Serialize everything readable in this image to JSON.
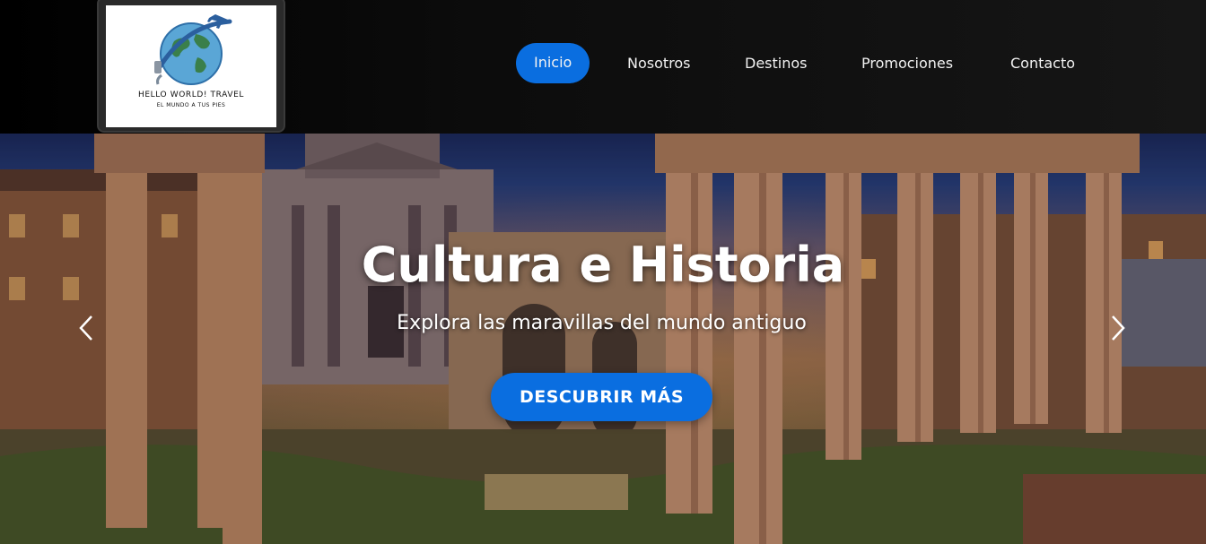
{
  "logo": {
    "title": "HELLO WORLD! TRAVEL",
    "subtitle": "EL MUNDO A TUS PIES",
    "icon": "globe-airplane-logo"
  },
  "nav": {
    "items": [
      {
        "label": "Inicio",
        "active": true
      },
      {
        "label": "Nosotros",
        "active": false
      },
      {
        "label": "Destinos",
        "active": false
      },
      {
        "label": "Promociones",
        "active": false
      },
      {
        "label": "Contacto",
        "active": false
      }
    ]
  },
  "hero": {
    "title": "Cultura e Historia",
    "subtitle": "Explora las maravillas del mundo antiguo",
    "cta_label": "DESCUBRIR MÁS",
    "prev_icon": "chevron-left-icon",
    "next_icon": "chevron-right-icon"
  },
  "colors": {
    "accent": "#0a6ee0",
    "header_bg": "#111111",
    "text": "#ffffff"
  }
}
